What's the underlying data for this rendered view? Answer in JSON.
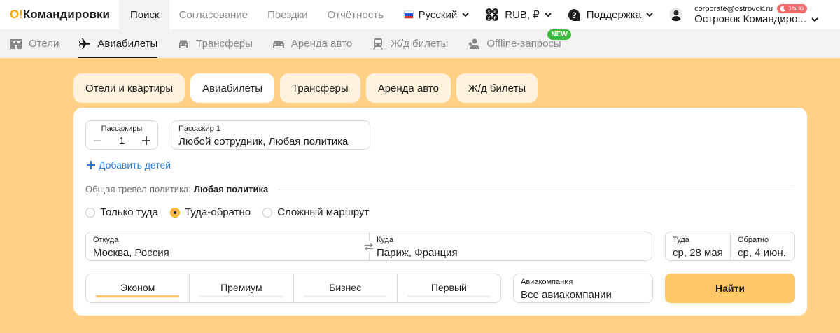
{
  "app": {
    "logo_prefix": "O!",
    "logo_name": "Командировки"
  },
  "topnav": {
    "items": [
      {
        "label": "Поиск"
      },
      {
        "label": "Согласование"
      },
      {
        "label": "Поездки"
      },
      {
        "label": "Отчётность"
      }
    ]
  },
  "topright": {
    "language": "Русский",
    "currency": "RUB, ₽",
    "support": "Поддержка",
    "email": "corporate@ostrovok.ru",
    "badge_count": "1536",
    "company": "Островок Командиро..."
  },
  "subtabs": {
    "items": [
      {
        "label": "Отели",
        "icon": "hotel-icon"
      },
      {
        "label": "Авиабилеты",
        "icon": "plane-icon"
      },
      {
        "label": "Трансферы",
        "icon": "car-icon"
      },
      {
        "label": "Аренда авто",
        "icon": "rental-car-icon"
      },
      {
        "label": "Ж/д билеты",
        "icon": "train-icon"
      },
      {
        "label": "Offline-запросы",
        "icon": "offline-request-icon"
      }
    ],
    "new_badge": "NEW"
  },
  "pills": {
    "items": [
      {
        "label": "Отели и квартиры"
      },
      {
        "label": "Авиабилеты"
      },
      {
        "label": "Трансферы"
      },
      {
        "label": "Аренда авто"
      },
      {
        "label": "Ж/д билеты"
      }
    ]
  },
  "form": {
    "passengers_label": "Пассажиры",
    "passengers_count": "1",
    "passenger1_label": "Пассажир 1",
    "passenger1_value": "Любой сотрудник, Любая политика",
    "add_children": "Добавить детей",
    "policy_label": "Общая тревел-политика:",
    "policy_value": "Любая политика",
    "trip_types": [
      {
        "label": "Только туда"
      },
      {
        "label": "Туда-обратно"
      },
      {
        "label": "Сложный маршрут"
      }
    ],
    "from_label": "Откуда",
    "from_value": "Москва, Россия",
    "to_label": "Куда",
    "to_value": "Париж, Франция",
    "depart_label": "Туда",
    "depart_value": "ср, 28 мая",
    "return_label": "Обратно",
    "return_value": "ср, 4 июн.",
    "classes": [
      {
        "label": "Эконом"
      },
      {
        "label": "Премиум"
      },
      {
        "label": "Бизнес"
      },
      {
        "label": "Первый"
      }
    ],
    "airline_label": "Авиакомпания",
    "airline_value": "Все авиакомпании",
    "search_button": "Найти"
  },
  "colors": {
    "page_bg": "#ffd085",
    "accent": "#ffc766",
    "link": "#2a7de1",
    "badge_red": "#f26b6b",
    "new_green": "#3ebb3e"
  }
}
